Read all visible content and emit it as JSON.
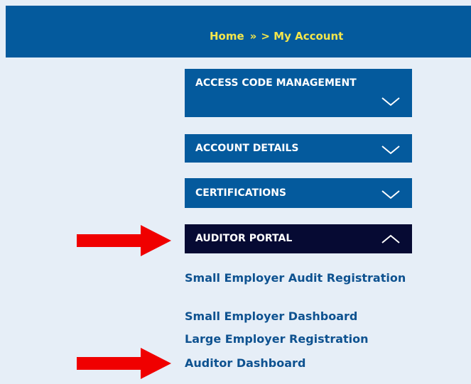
{
  "breadcrumb": {
    "home": "Home",
    "separator": "»",
    "current": "> My Account"
  },
  "panels": [
    {
      "label": "ACCESS CODE MANAGEMENT",
      "state": "collapsed",
      "icon": "chevron-down-icon"
    },
    {
      "label": "ACCOUNT DETAILS",
      "state": "collapsed",
      "icon": "chevron-down-icon"
    },
    {
      "label": "CERTIFICATIONS",
      "state": "collapsed",
      "icon": "chevron-down-icon"
    },
    {
      "label": "AUDITOR PORTAL",
      "state": "expanded",
      "icon": "chevron-up-icon"
    }
  ],
  "auditor_portal_links": [
    "Small Employer Audit Registration",
    "Small Employer Dashboard",
    "Large Employer Registration",
    "Auditor Dashboard"
  ],
  "annotations": {
    "arrow_icon": "red-arrow-right-icon",
    "arrow_color": "#f00000"
  },
  "colors": {
    "header_bg": "#045a9d",
    "breadcrumb_text": "#f4e64b",
    "panel_bg": "#045a9d",
    "panel_active_bg": "#060a33",
    "link_text": "#0e5290",
    "page_bg": "#e6eef7"
  }
}
